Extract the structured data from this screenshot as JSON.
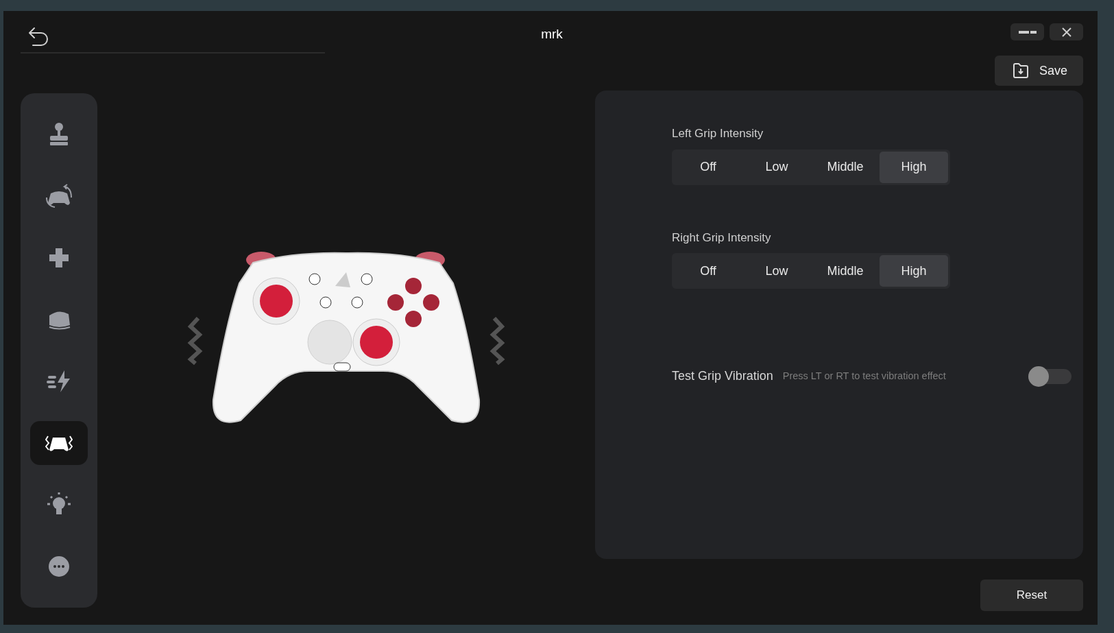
{
  "window": {
    "title": "mrk"
  },
  "sidebar": {
    "items": [
      {
        "kind": "joystick",
        "selected": false
      },
      {
        "kind": "remap",
        "selected": false
      },
      {
        "kind": "dpad",
        "selected": false
      },
      {
        "kind": "trigger",
        "selected": false
      },
      {
        "kind": "turbo",
        "selected": false
      },
      {
        "kind": "vibration",
        "selected": true
      },
      {
        "kind": "light",
        "selected": false
      },
      {
        "kind": "more",
        "selected": false
      }
    ]
  },
  "save_button": "Save",
  "settings": [
    {
      "label": "Left Grip Intensity",
      "options": [
        {
          "label": "Off",
          "selected": false
        },
        {
          "label": "Low",
          "selected": false
        },
        {
          "label": "Middle",
          "selected": false
        },
        {
          "label": "High",
          "selected": true
        }
      ]
    },
    {
      "label": "Right Grip Intensity",
      "options": [
        {
          "label": "Off",
          "selected": false
        },
        {
          "label": "Low",
          "selected": false
        },
        {
          "label": "Middle",
          "selected": false
        },
        {
          "label": "High",
          "selected": true
        }
      ]
    }
  ],
  "test": {
    "label": "Test Grip Vibration",
    "hint": "Press LT or RT to test vibration effect",
    "on": false
  },
  "reset_button": "Reset"
}
